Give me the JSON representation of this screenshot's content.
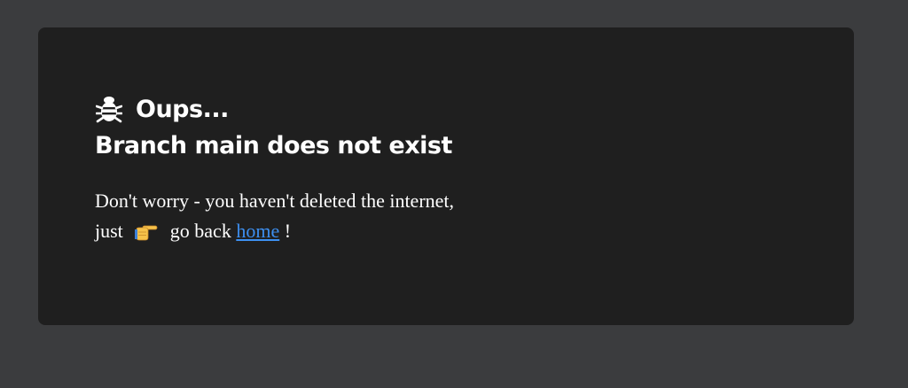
{
  "heading": {
    "icon": "bug-icon",
    "text": "Oups..."
  },
  "subtitle": "Branch main does not exist",
  "message": {
    "line1": "Don't worry - you haven't deleted the internet,",
    "line2_prefix": "just",
    "pointer_icon": "pointing-right-icon",
    "line2_middle": "go back",
    "link_text": "home",
    "line2_suffix": "!"
  },
  "colors": {
    "background": "#3b3c3e",
    "card": "#1f1f1f",
    "text": "#ffffff",
    "link": "#3d8ff0"
  }
}
